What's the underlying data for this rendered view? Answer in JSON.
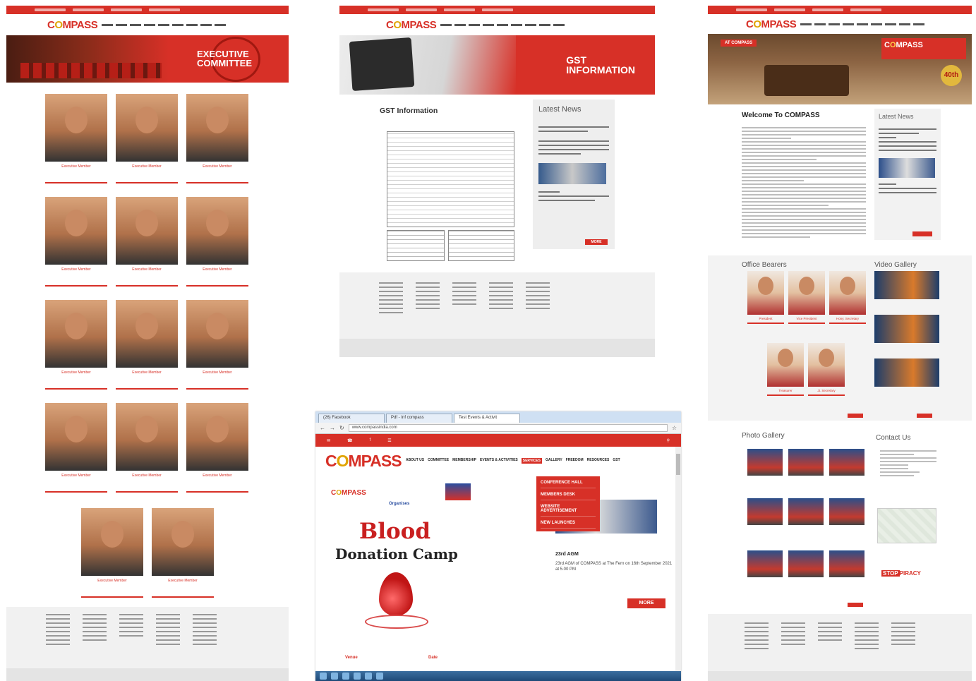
{
  "brand": {
    "logo_text": "C",
    "logo_o": "O",
    "logo_rest": "MPASS",
    "accent": "#d73027",
    "gold": "#e0a400"
  },
  "left_panel": {
    "banner_title_line1": "EXECUTIVE",
    "banner_title_line2": "COMMITTEE",
    "members": [
      {
        "role": "Executive Member"
      },
      {
        "role": "Executive Member"
      },
      {
        "role": "Executive Member"
      },
      {
        "role": "Executive Member"
      },
      {
        "role": "Executive Member"
      },
      {
        "role": "Executive Member"
      },
      {
        "role": "Executive Member"
      },
      {
        "role": "Executive Member"
      },
      {
        "role": "Executive Member"
      },
      {
        "role": "Executive Member"
      },
      {
        "role": "Executive Member"
      },
      {
        "role": "Executive Member"
      },
      {
        "role": "Executive Member"
      },
      {
        "role": "Executive Member"
      }
    ]
  },
  "mid_panel": {
    "banner_title_line1": "GST",
    "banner_title_line2": "INFORMATION",
    "heading": "GST Information",
    "news_heading": "Latest News",
    "more_label": "MORE"
  },
  "right_panel": {
    "banner_caption": "AT COMPASS",
    "badge": "40th",
    "welcome_heading": "Welcome To COMPASS",
    "news_heading": "Latest News",
    "office_bearers_heading": "Office Bearers",
    "video_gallery_heading": "Video Gallery",
    "photo_gallery_heading": "Photo Gallery",
    "contact_heading": "Contact Us",
    "bearers": [
      {
        "role": "President"
      },
      {
        "role": "Vice President"
      },
      {
        "role": "Hony. Secretary"
      },
      {
        "role": "Treasurer"
      },
      {
        "role": "Jt. Secretary"
      }
    ],
    "stop_piracy_a": "STOP",
    "stop_piracy_b": "PIRACY"
  },
  "browser": {
    "tabs": [
      "(26) Facebook",
      "Pdf - Inf compass",
      "Test Events & Activit"
    ],
    "url": "www.compassindia.com",
    "site_nav": [
      "ABOUT US",
      "COMMITTEE",
      "MEMBERSHIP",
      "EVENTS & ACTIVITIES",
      "SERVICES",
      "GALLERY",
      "FREEDOM",
      "RESOURCES",
      "GST"
    ],
    "dropdown": [
      "CONFERENCE HALL",
      "MEMBERS DESK",
      "WEBSITE ADVERTISEMENT",
      "NEW LAUNCHES"
    ],
    "organises": "Organises",
    "blood_title": "Blood",
    "blood_sub": "Donation Camp",
    "venue_label": "Venue",
    "date_label": "Date",
    "agm_title": "23rd AGM",
    "agm_body": "23rd AGM of COMPASS at The Fern on 16th September 2021 at 5.00 PM",
    "more_label": "MORE"
  }
}
